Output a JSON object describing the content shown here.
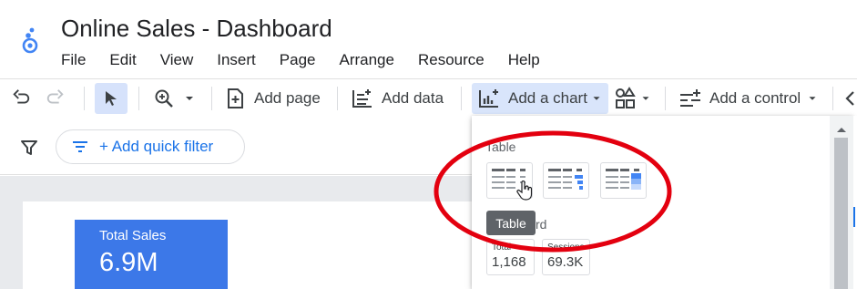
{
  "app": {
    "title": "Online Sales - Dashboard",
    "menu": [
      "File",
      "Edit",
      "View",
      "Insert",
      "Page",
      "Arrange",
      "Resource",
      "Help"
    ]
  },
  "toolbar": {
    "add_page": "Add page",
    "add_data": "Add data",
    "add_chart": "Add a chart",
    "add_control": "Add a control"
  },
  "filter": {
    "quick_filter_label": "+ Add quick filter"
  },
  "canvas": {
    "scorecard_label": "Total Sales",
    "scorecard_value": "6.9M"
  },
  "chart_menu": {
    "table_section": "Table",
    "scorecard_section_partial": "rd",
    "tooltip": "Table",
    "scorecards": [
      {
        "label": "Total",
        "value": "1,168"
      },
      {
        "label": "Sessions",
        "value": "69.3K"
      }
    ]
  },
  "colors": {
    "accent": "#1a73e8",
    "scorecard_bg": "#3c78e8",
    "highlight": "#e3000f"
  }
}
